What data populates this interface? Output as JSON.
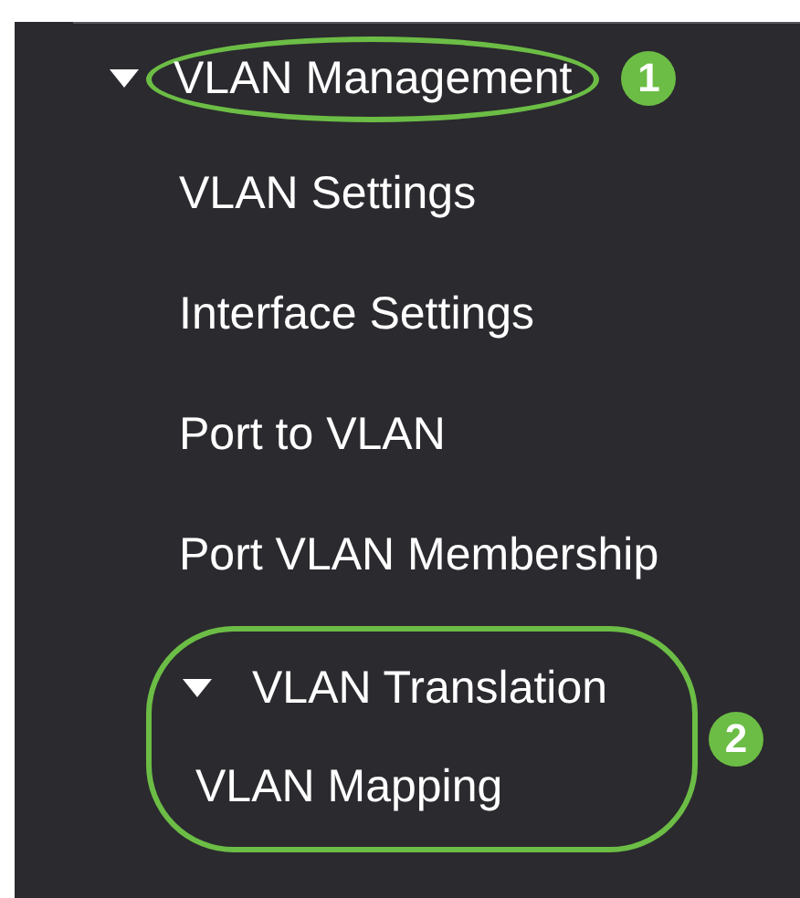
{
  "menu": {
    "label": "VLAN Management",
    "expanded": true,
    "callout": "1",
    "children": [
      {
        "label": "VLAN Settings"
      },
      {
        "label": "Interface Settings"
      },
      {
        "label": "Port to VLAN"
      },
      {
        "label": "Port VLAN Membership"
      },
      {
        "label": "VLAN Translation",
        "expanded": true,
        "callout": "2",
        "children": [
          {
            "label": "VLAN Mapping"
          }
        ]
      }
    ]
  }
}
